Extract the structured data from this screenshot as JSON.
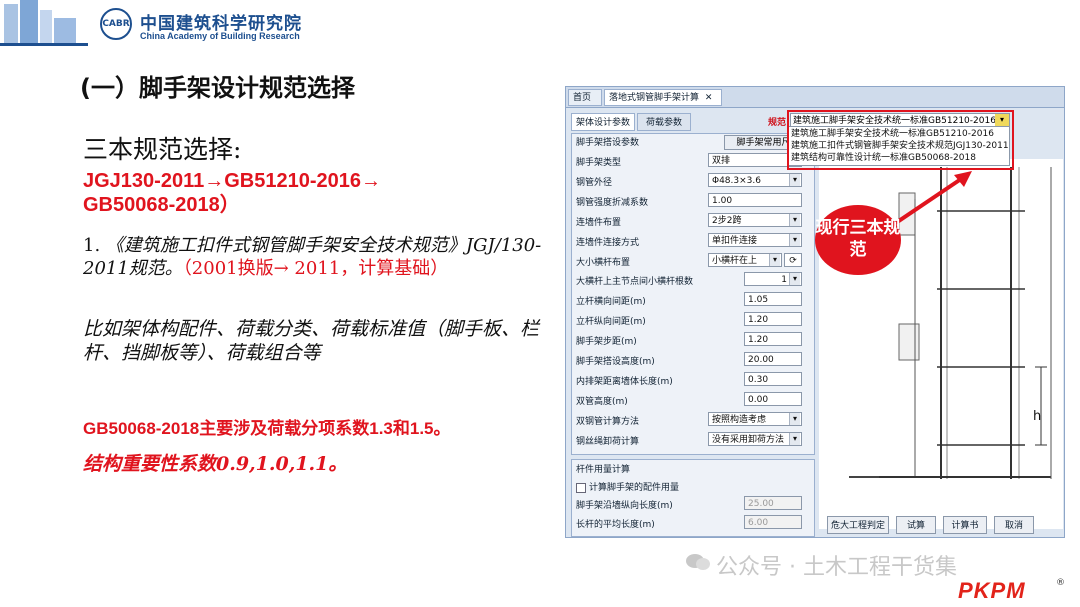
{
  "header": {
    "org_cn": "中国建筑科学研究院",
    "org_en": "China Academy of Building Research",
    "seal_text": "CABR"
  },
  "slide": {
    "title": "(一）脚手架设计规范选择",
    "subtitle": "三本规范选择:",
    "codes_line1": "JGJ130-2011→GB51210-2016→",
    "codes_line2": "GB50068-2018）",
    "item1_num": "1.",
    "item1_text": "《建筑施工扣件式钢管脚手架安全技术规范》JGJ/130-2011规范。",
    "item1_red": "（2001换版→ 2011，计算基础）",
    "example": "比如架体构配件、荷载分类、荷载标准值（脚手板、栏杆、挡脚板等）、荷载组合等",
    "gb_note": "GB50068-2018主要涉及荷载分项系数1.3和1.5。",
    "importance": "结构重要性系数0.9,1.0,1.1。"
  },
  "software": {
    "tab_home": "首页",
    "tab_calc": "落地式钢管脚手架计算",
    "tab_close": "✕",
    "panel_tab1": "架体设计参数",
    "panel_tab2": "荷载参数",
    "params_header": "脚手架搭设参数",
    "common_size_button": "脚手架常用尺寸",
    "params": [
      {
        "label": "脚手架类型",
        "value": "双排"
      },
      {
        "label": "钢管外径",
        "value": "Φ48.3×3.6"
      },
      {
        "label": "钢管强度折减系数",
        "value": "1.00"
      },
      {
        "label": "连墙件布置",
        "value": "2步2跨"
      },
      {
        "label": "连墙件连接方式",
        "value": "单扣件连接"
      },
      {
        "label": "大小横杆布置",
        "value": "小横杆在上"
      },
      {
        "label": "大横杆上主节点间小横杆根数",
        "value": "1"
      },
      {
        "label": "立杆横向间距(m)",
        "value": "1.05"
      },
      {
        "label": "立杆纵向间距(m)",
        "value": "1.20"
      },
      {
        "label": "脚手架步距(m)",
        "value": "1.20"
      },
      {
        "label": "脚手架搭设高度(m)",
        "value": "20.00"
      },
      {
        "label": "内排架距离墙体长度(m)",
        "value": "0.30"
      },
      {
        "label": "双管高度(m)",
        "value": "0.00"
      },
      {
        "label": "双钢管计算方法",
        "value": "按照构造考虑"
      },
      {
        "label": "钢丝绳卸荷计算",
        "value": "没有采用卸荷方法"
      }
    ],
    "members_header": "杆件用量计算",
    "members_checkbox": "计算脚手架的配件用量",
    "members_rows": [
      {
        "label": "脚手架沿墙纵向长度(m)",
        "value": "25.00"
      },
      {
        "label": "长杆的平均长度(m)",
        "value": "6.00"
      }
    ],
    "std_label": "规范",
    "std_selected": "建筑施工脚手架安全技术统一标准GB51210-2016",
    "std_options": [
      "建筑施工脚手架安全技术统一标准GB51210-2016",
      "建筑施工扣件式钢管脚手架安全技术规范JGJ130-2011",
      "建筑结构可靠性设计统一标准GB50068-2018"
    ],
    "callout": "现行三本规范",
    "dimension_label": "h",
    "buttons": {
      "judge": "危大工程判定",
      "calc": "试算",
      "book": "计算书",
      "cancel": "取消"
    }
  },
  "watermark": {
    "text": "公众号 · 土木工程干货集",
    "brand": "PKPM",
    "reg": "®"
  },
  "colors": {
    "accent_red": "#e0141e",
    "brand_blue": "#1d4f8f"
  }
}
